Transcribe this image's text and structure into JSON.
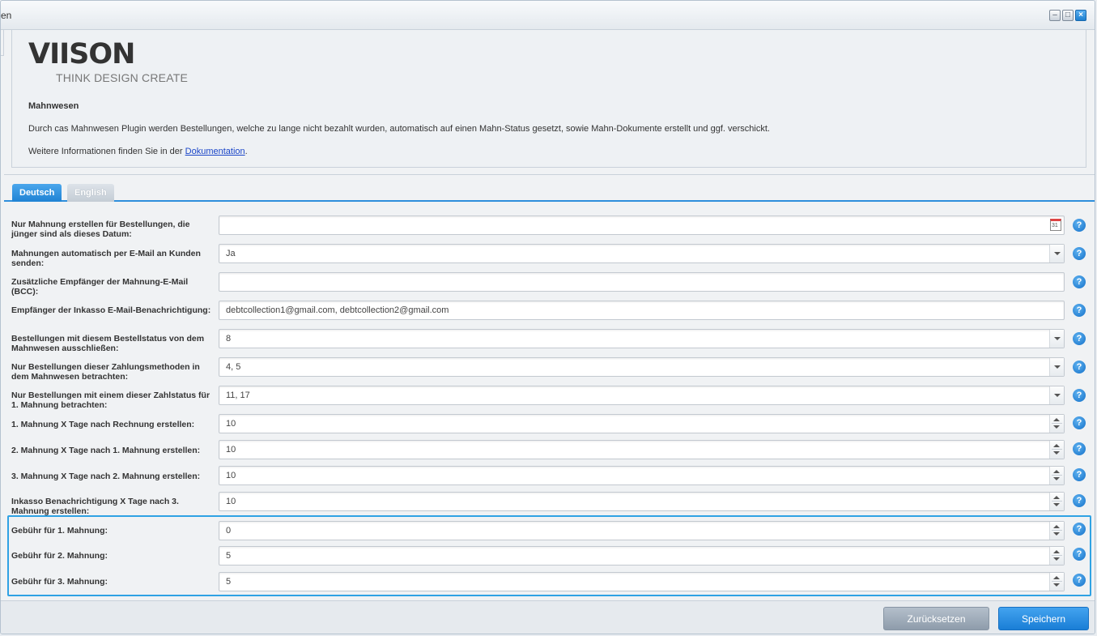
{
  "window": {
    "title": "en"
  },
  "header": {
    "logo": "VIISON",
    "tagline": "THINK DESIGN CREATE",
    "title": "Mahnwesen",
    "description": "Durch cas Mahnwesen Plugin werden Bestellungen, welche zu lange nicht bezahlt wurden, automatisch auf einen Mahn-Status gesetzt, sowie Mahn-Dokumente erstellt und ggf. verschickt.",
    "info_prefix": "Weitere Informationen finden Sie in der ",
    "info_link": "Dokumentation",
    "info_suffix": "."
  },
  "tabs": [
    {
      "label": "Deutsch",
      "active": true
    },
    {
      "label": "English",
      "active": false
    }
  ],
  "fields": [
    {
      "label": "Nur Mahnung erstellen für Bestellungen, die jünger sind als dieses Datum:",
      "value": "",
      "type": "date"
    },
    {
      "label": "Mahnungen automatisch per E-Mail an Kunden senden:",
      "value": "Ja",
      "type": "combo"
    },
    {
      "label": "Zusätzliche Empfänger der Mahnung-E-Mail (BCC):",
      "value": "",
      "type": "text"
    },
    {
      "label": "Empfänger der Inkasso E-Mail-Benachrichtigung:",
      "value": "debtcollection1@gmail.com, debtcollection2@gmail.com",
      "type": "text"
    },
    {
      "label": "Bestellungen mit diesem Bestellstatus von dem Mahnwesen ausschließen:",
      "value": "8",
      "type": "combo"
    },
    {
      "label": "Nur Bestellungen dieser Zahlungsmethoden in dem Mahnwesen betrachten:",
      "value": "4, 5",
      "type": "combo"
    },
    {
      "label": "Nur Bestellungen mit einem dieser Zahlstatus für 1. Mahnung betrachten:",
      "value": "11, 17",
      "type": "combo"
    },
    {
      "label": "1. Mahnung X Tage nach Rechnung erstellen:",
      "value": "10",
      "type": "number"
    },
    {
      "label": "2. Mahnung X Tage nach 1. Mahnung erstellen:",
      "value": "10",
      "type": "number"
    },
    {
      "label": "3. Mahnung X Tage nach 2. Mahnung erstellen:",
      "value": "10",
      "type": "number"
    },
    {
      "label": "Inkasso Benachrichtigung X Tage nach 3. Mahnung erstellen:",
      "value": "10",
      "type": "number"
    },
    {
      "label": "Gebühr für 1. Mahnung:",
      "value": "0",
      "type": "number"
    },
    {
      "label": "Gebühr für 2. Mahnung:",
      "value": "5",
      "type": "number"
    },
    {
      "label": "Gebühr für 3. Mahnung:",
      "value": "5",
      "type": "number"
    }
  ],
  "help_glyph": "?",
  "footer": {
    "reset_label": "Zurücksetzen",
    "save_label": "Speichern"
  },
  "colors": {
    "accent": "#2e8edc",
    "highlight": "#2fa2e4"
  }
}
